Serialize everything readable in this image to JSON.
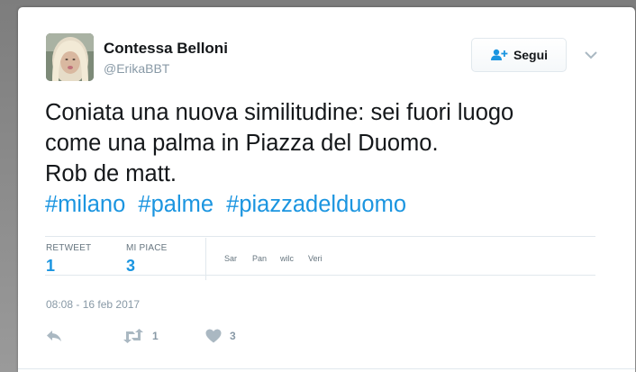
{
  "user": {
    "name": "Contessa Belloni",
    "handle": "@ErikaBBT"
  },
  "follow_button": {
    "label": "Segui",
    "icon": "follow-user-icon"
  },
  "tweet": {
    "lines": [
      "Coniata una nuova similitudine: sei fuori luogo",
      "come una palma in Piazza del Duomo.",
      "Rob de matt."
    ],
    "hashtags": [
      "#milano",
      "#palme",
      "#piazzadelduomo"
    ]
  },
  "stats": {
    "retweet_label": "RETWEET",
    "retweet_count": "1",
    "likes_label": "MI PIACE",
    "likes_count": "3"
  },
  "likers": [
    "Sar",
    "Pan",
    "wilc",
    "Veri"
  ],
  "timestamp": "08:08 - 16 feb 2017",
  "actions": {
    "reply_icon": "reply-icon",
    "retweet_icon": "retweet-icon",
    "retweet_count": "1",
    "like_icon": "heart-icon",
    "like_count": "3"
  },
  "colors": {
    "link": "#1b95e0",
    "muted": "#8899a6",
    "text": "#14171a"
  }
}
